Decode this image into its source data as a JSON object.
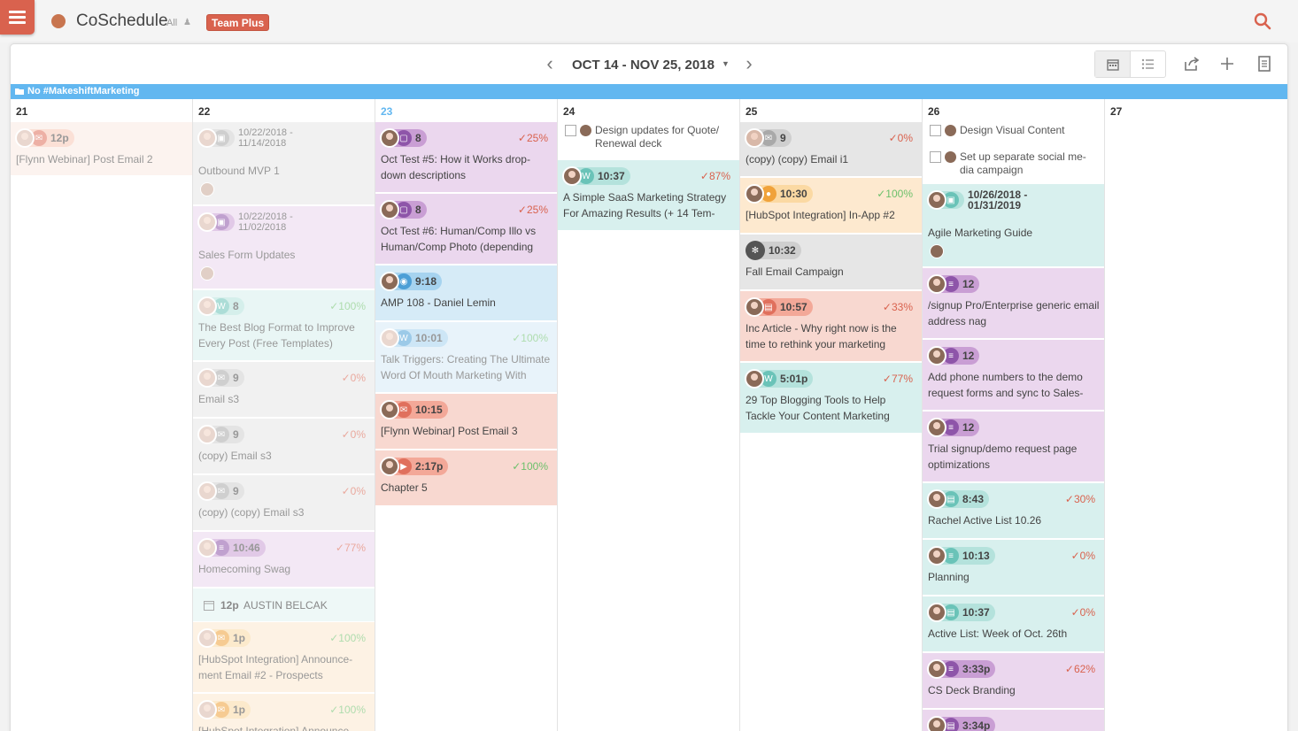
{
  "app": {
    "title": "CoSchedule",
    "filter_label": "All",
    "plan_badge": "Team Plus"
  },
  "header": {
    "date_range": "OCT 14 - NOV 25, 2018"
  },
  "campaign": {
    "label": "No #MakeshiftMarketing"
  },
  "days": {
    "d21": "21",
    "d22": "22",
    "d23": "23",
    "d24": "24",
    "d25": "25",
    "d26": "26",
    "d27": "27"
  },
  "col21": {
    "c1": {
      "time": "12p",
      "title": "[Flynn Webinar] Post Email 2"
    }
  },
  "col22": {
    "c1": {
      "time": "10/22/2018 - 11/14/2018",
      "title": "Outbound MVP 1"
    },
    "c2": {
      "time": "10/22/2018 - 11/02/2018",
      "title": "Sales Form Updates"
    },
    "c3": {
      "time": "8",
      "pct": "✓100%",
      "title": "The Best Blog Format to Improve Every Post (Free Templates)"
    },
    "c4": {
      "time": "9",
      "pct": "✓0%",
      "title": "Email s3"
    },
    "c5": {
      "time": "9",
      "pct": "✓0%",
      "title": "(copy) Email s3"
    },
    "c6": {
      "time": "9",
      "pct": "✓0%",
      "title": "(copy) (copy) Email s3"
    },
    "c7": {
      "time": "10:46",
      "pct": "✓77%",
      "title": "Homecoming Swag"
    },
    "event": {
      "time": "12p",
      "name": "AUSTIN BELCAK"
    },
    "c8": {
      "time": "1p",
      "pct": "✓100%",
      "title": "[HubSpot Integration] Announce- ment Email #2 - Prospects"
    },
    "c9": {
      "time": "1p",
      "pct": "✓100%",
      "title": "[HubSpot Integration] Announce-"
    }
  },
  "col23": {
    "c1": {
      "time": "8",
      "pct": "✓25%",
      "title": "Oct Test #5: How it Works drop- down descriptions"
    },
    "c2": {
      "time": "8",
      "pct": "✓25%",
      "title": "Oct Test #6: Human/Comp Illo vs Human/Comp Photo (depending"
    },
    "c3": {
      "time": "9:18",
      "title": "AMP 108 - Daniel Lemin"
    },
    "c4": {
      "time": "10:01",
      "pct": "✓100%",
      "title": "Talk Triggers: Creating The Ultimate Word Of Mouth Marketing With"
    },
    "c5": {
      "time": "10:15",
      "title": "[Flynn Webinar] Post Email 3"
    },
    "c6": {
      "time": "2:17p",
      "pct": "✓100%",
      "title": "Chapter 5"
    }
  },
  "col24": {
    "task1": "Design updates for Quote/ Renewal deck",
    "c1": {
      "time": "10:37",
      "pct": "✓87%",
      "title": "A Simple SaaS Marketing Strategy For Amazing Results (+ 14 Tem-"
    }
  },
  "col25": {
    "c1": {
      "time": "9",
      "pct": "✓0%",
      "title": "(copy) (copy) Email i1"
    },
    "c2": {
      "time": "10:30",
      "pct": "✓100%",
      "title": "[HubSpot Integration] In-App #2"
    },
    "c3": {
      "time": "10:32",
      "title": "Fall Email Campaign"
    },
    "c4": {
      "time": "10:57",
      "pct": "✓33%",
      "title": "Inc Article - Why right now is the time to rethink your marketing"
    },
    "c5": {
      "time": "5:01p",
      "pct": "✓77%",
      "title": "29 Top Blogging Tools to Help Tackle Your Content Marketing"
    }
  },
  "col26": {
    "task1": "Design Visual Content",
    "task2": "Set up separate social me- dia campaign",
    "c1": {
      "time": "10/26/2018 - 01/31/2019",
      "title": "Agile Marketing Guide"
    },
    "c2": {
      "time": "12",
      "title": "/signup Pro/Enterprise generic email address nag"
    },
    "c3": {
      "time": "12",
      "title": "Add phone numbers to the demo request forms and sync to Sales-"
    },
    "c4": {
      "time": "12",
      "title": "Trial signup/demo request page optimizations"
    },
    "c5": {
      "time": "8:43",
      "pct": "✓30%",
      "title": "Rachel Active List 10.26"
    },
    "c6": {
      "time": "10:13",
      "pct": "✓0%",
      "title": "Planning"
    },
    "c7": {
      "time": "10:37",
      "pct": "✓0%",
      "title": "Active List: Week of Oct. 26th"
    },
    "c8": {
      "time": "3:33p",
      "pct": "✓62%",
      "title": "CS Deck Branding"
    },
    "c9": {
      "time": "3:34p"
    }
  },
  "colors": {
    "accent": "#d9624e",
    "campaign": "#62b7f0",
    "today": "#62b7f0"
  }
}
